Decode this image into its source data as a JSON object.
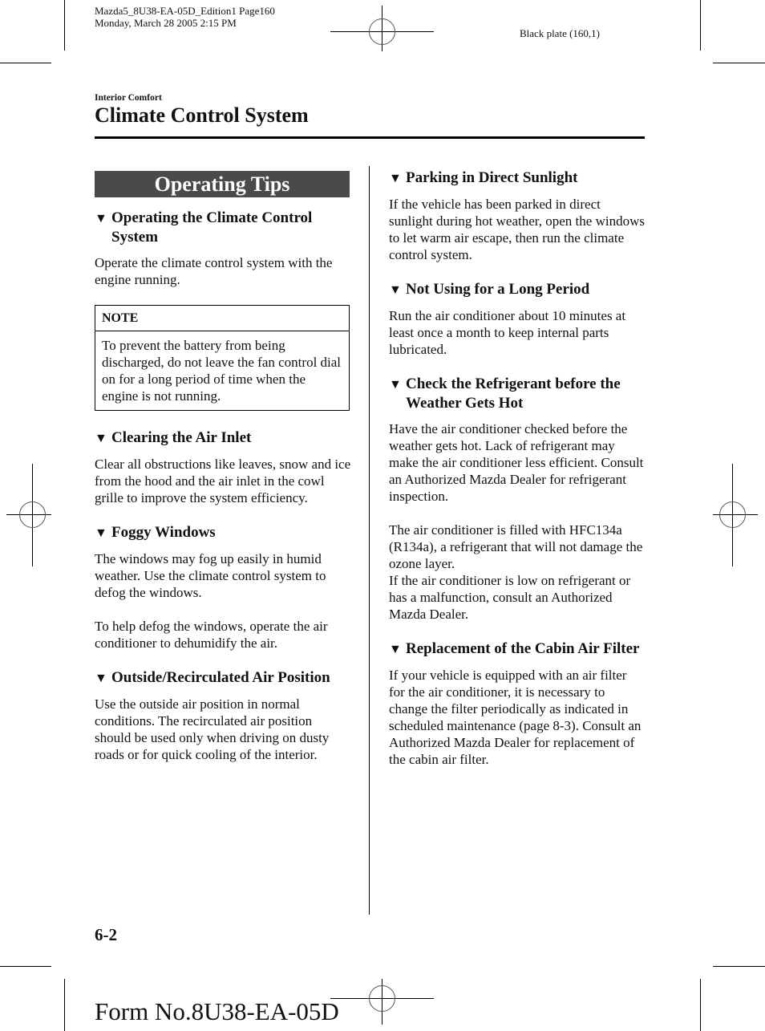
{
  "print_slug": {
    "line1": "Mazda5_8U38-EA-05D_Edition1 Page160",
    "line2": "Monday, March 28 2005 2:15 PM",
    "plate": "Black plate (160,1)"
  },
  "header": {
    "section": "Interior Comfort",
    "title": "Climate Control System"
  },
  "banner": "Operating Tips",
  "bullet_icon": "▼",
  "left_column": {
    "s1": {
      "heading": "Operating the Climate Control System",
      "body": "Operate the climate control system with the engine running."
    },
    "note": {
      "label": "NOTE",
      "body": "To prevent the battery from being discharged, do not leave the fan control dial on for a long period of time when the engine is not running."
    },
    "s2": {
      "heading": "Clearing the Air Inlet",
      "body": "Clear all obstructions like leaves, snow and ice from the hood and the air inlet in the cowl grille to improve the system efficiency."
    },
    "s3": {
      "heading": "Foggy Windows",
      "body1": "The windows may fog up easily in humid weather. Use the climate control system to defog the windows.",
      "body2": "To help defog the windows, operate the air conditioner to dehumidify the air."
    },
    "s4": {
      "heading": "Outside/Recirculated Air Position",
      "body": "Use the outside air position in normal conditions. The recirculated air position should be used only when driving on dusty roads or for quick cooling of the interior."
    }
  },
  "right_column": {
    "s1": {
      "heading": "Parking in Direct Sunlight",
      "body": "If the vehicle has been parked in direct sunlight during hot weather, open the windows to let warm air escape, then run the climate control system."
    },
    "s2": {
      "heading": "Not Using for a Long Period",
      "body": "Run the air conditioner about 10 minutes at least once a month to keep internal parts lubricated."
    },
    "s3": {
      "heading": "Check the Refrigerant before the Weather Gets Hot",
      "body1": "Have the air conditioner checked before the weather gets hot. Lack of refrigerant may make the air conditioner less efficient. Consult an Authorized Mazda Dealer for refrigerant inspection.",
      "body2": "The air conditioner is filled with HFC134a (R134a), a refrigerant that will not damage the ozone layer.",
      "body3": "If the air conditioner is low on refrigerant or has a malfunction, consult an Authorized Mazda Dealer."
    },
    "s4": {
      "heading": "Replacement of the Cabin Air Filter",
      "body": "If your vehicle is equipped with an air filter for the air conditioner, it is necessary to change the filter periodically as indicated in scheduled maintenance (page 8-3). Consult an Authorized Mazda Dealer for replacement of the cabin air filter."
    }
  },
  "footer": {
    "page_number": "6-2",
    "form_number": "Form No.8U38-EA-05D"
  }
}
